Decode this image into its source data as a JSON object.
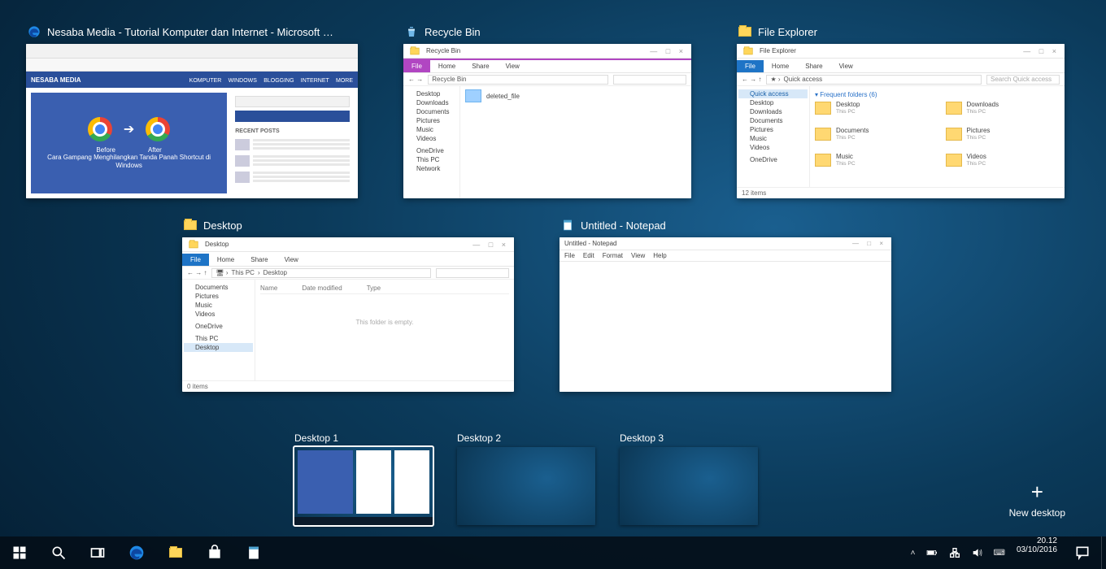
{
  "taskview": {
    "windows": {
      "edge": {
        "title": "Nesaba Media - Tutorial Komputer dan Internet - Microsoft Ed...",
        "brand": "NESABA MEDIA",
        "nav": [
          "KOMPUTER",
          "WINDOWS",
          "BLOGGING",
          "INTERNET",
          "MORE"
        ],
        "hero_before": "Before",
        "hero_after": "After",
        "hero_caption": "Cara Gampang Menghilangkan Tanda Panah Shortcut di Windows",
        "recent_label": "RECENT POSTS"
      },
      "recycle": {
        "title": "Recycle Bin"
      },
      "explorer": {
        "title": "File Explorer",
        "wintitle": "File Explorer",
        "tabs": [
          "File",
          "Home",
          "Share",
          "View"
        ],
        "breadcrumb": "Quick access",
        "search_placeholder": "Search Quick access",
        "freq_label": "Frequent folders (6)",
        "quick": [
          "Quick access",
          "Desktop",
          "Downloads",
          "Documents",
          "Pictures",
          "Music",
          "Videos",
          "OneDrive"
        ],
        "folders": [
          {
            "name": "Desktop",
            "loc": "This PC"
          },
          {
            "name": "Downloads",
            "loc": "This PC"
          },
          {
            "name": "Documents",
            "loc": "This PC"
          },
          {
            "name": "Pictures",
            "loc": "This PC"
          },
          {
            "name": "Music",
            "loc": "This PC"
          },
          {
            "name": "Videos",
            "loc": "This PC"
          }
        ],
        "status": "12 items"
      },
      "desktop": {
        "title": "Desktop",
        "tabs": [
          "File",
          "Home",
          "Share",
          "View"
        ],
        "path_root": "This PC",
        "path_leaf": "Desktop",
        "nav": [
          "Documents",
          "Pictures",
          "Music",
          "Videos",
          "OneDrive",
          "This PC",
          "Desktop"
        ],
        "cols": [
          "Name",
          "Date modified",
          "Type"
        ],
        "empty": "This folder is empty.",
        "status": "0 items"
      },
      "notepad": {
        "title": "Untitled - Notepad",
        "wintitle": "Untitled - Notepad",
        "menus": [
          "File",
          "Edit",
          "Format",
          "View",
          "Help"
        ]
      }
    }
  },
  "desktops": {
    "items": [
      {
        "label": "Desktop 1",
        "selected": true
      },
      {
        "label": "Desktop 2",
        "selected": false
      },
      {
        "label": "Desktop 3",
        "selected": false
      }
    ],
    "new_label": "New desktop"
  },
  "taskbar": {
    "time": "20.12",
    "date": "03/10/2016"
  }
}
